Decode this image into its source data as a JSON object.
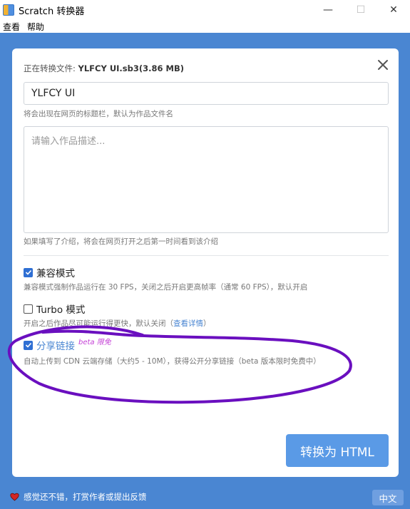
{
  "window": {
    "title": "Scratch 转换器",
    "minimize": "—",
    "maximize": "☐",
    "close": "✕"
  },
  "menu": [
    {
      "label": "查看"
    },
    {
      "label": "帮助"
    }
  ],
  "dialog": {
    "file_prefix": "正在转换文件:",
    "file_name": "YLFCY UI.sb3(3.86 MB)",
    "title_value": "YLFCY UI",
    "title_hint": "将会出现在网页的标题栏，默认为作品文件名",
    "desc_placeholder": "请输入作品描述...",
    "desc_hint": "如果填写了介绍，将会在网页打开之后第一时间看到该介绍",
    "options": [
      {
        "label": "兼容模式",
        "checked": true,
        "hint": "兼容模式强制作品运行在 30 FPS，关闭之后开启更高帧率（通常 60 FPS），默认开启"
      },
      {
        "label": "Turbo 模式",
        "checked": false,
        "hint_before": "开启之后作品尽可能运行得更快，默认关闭（",
        "hint_link": "查看详情",
        "hint_after": "）"
      },
      {
        "label": "分享链接",
        "checked": true,
        "badge": "beta 限免",
        "hint": "自动上传到 CDN 云端存储（大约5 - 10M），获得公开分享链接（beta 版本限时免费中）"
      }
    ],
    "convert_label": "转换为 HTML"
  },
  "footer": {
    "feedback": "感觉还不错，打赏作者或提出反馈",
    "language": "中文"
  },
  "colors": {
    "background": "#4a86d2",
    "button": "#5a9ae6",
    "checkbox": "#2f6fd3",
    "annotation": "#6a0fbf"
  }
}
